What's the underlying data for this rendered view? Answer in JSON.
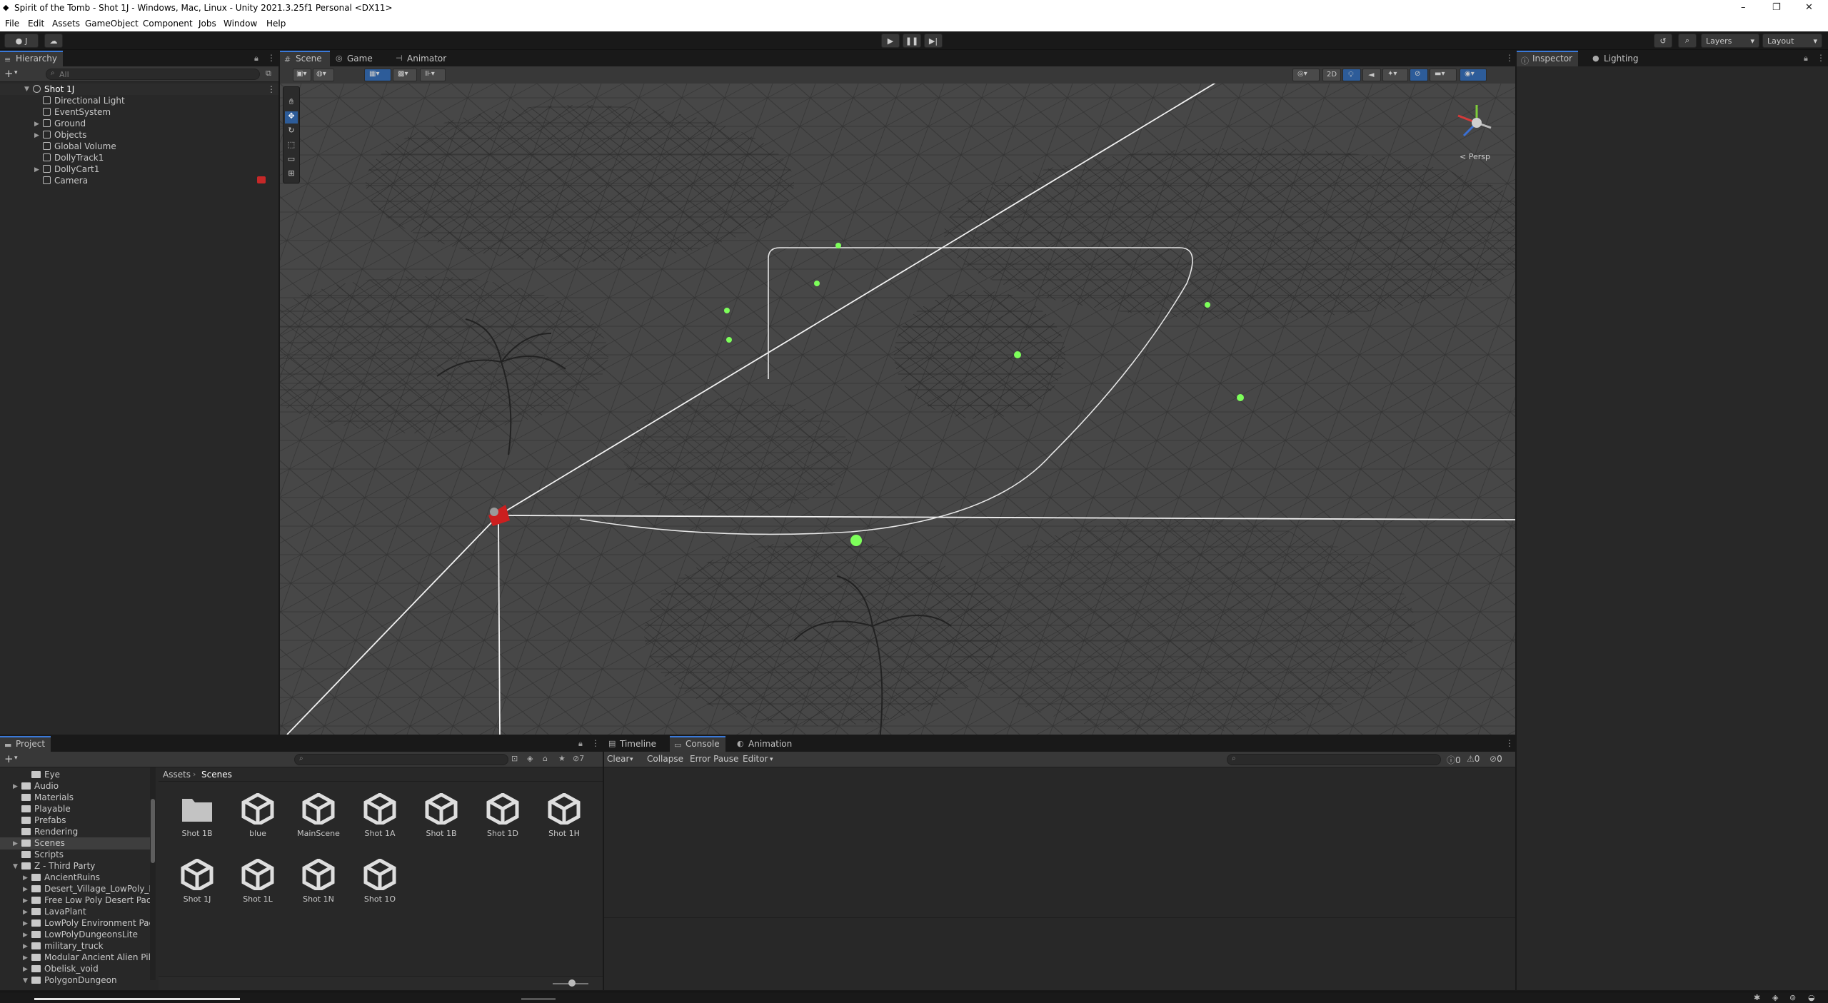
{
  "window": {
    "title": "Spirit of the Tomb - Shot 1J - Windows, Mac, Linux - Unity 2021.3.25f1 Personal <DX11>",
    "controls": [
      "–",
      "❐",
      "✕"
    ]
  },
  "menu": [
    "File",
    "Edit",
    "Assets",
    "GameObject",
    "Component",
    "Jobs",
    "Window",
    "Help"
  ],
  "toolbar": {
    "account": "J",
    "play_icon": "play-icon",
    "pause_icon": "pause-icon",
    "step_icon": "step-icon",
    "layers": "Layers",
    "layout": "Layout"
  },
  "hierarchy": {
    "tab": "Hierarchy",
    "search_placeholder": "All",
    "scene": "Shot 1J",
    "items": [
      "Directional Light",
      "EventSystem",
      "Ground",
      "Objects",
      "Global Volume",
      "DollyTrack1",
      "DollyCart1",
      "Camera"
    ]
  },
  "scene_tabs": [
    "Scene",
    "Game",
    "Animator"
  ],
  "scene_view": {
    "btn_2d": "2D",
    "persp": "< Persp"
  },
  "right_tabs": [
    "Inspector",
    "Lighting"
  ],
  "project": {
    "tab": "Project",
    "tree": [
      "Eye",
      "Audio",
      "Materials",
      "Playable",
      "Prefabs",
      "Rendering",
      "Scenes",
      "Scripts",
      "Z - Third Party",
      "AncientRuins",
      "Desert_Village_LowPoly_H",
      "Free Low Poly Desert Pacl",
      "LavaPlant",
      "LowPoly Environment Pac",
      "LowPolyDungeonsLite",
      "military_truck",
      "Modular Ancient Alien Pilla",
      "Obelisk_void",
      "PolygonDungeon"
    ],
    "breadcrumb": [
      "Assets",
      "Scenes"
    ],
    "assets": [
      "Shot 1B",
      "blue",
      "MainScene",
      "Shot 1A",
      "Shot 1B",
      "Shot 1D",
      "Shot 1H",
      "Shot 1J",
      "Shot 1L",
      "Shot 1N",
      "Shot 1O"
    ],
    "hidden_count": "7"
  },
  "bottom_tabs": [
    "Timeline",
    "Console",
    "Animation"
  ],
  "console": {
    "clear": "Clear",
    "collapse": "Collapse",
    "error_pause": "Error Pause",
    "editor": "Editor",
    "counts": [
      "0",
      "0",
      "0"
    ]
  },
  "colors": {
    "accent": "#3a79d9",
    "light_gizmo": "#7dff5a",
    "camera_gizmo": "#cc1f1f"
  }
}
